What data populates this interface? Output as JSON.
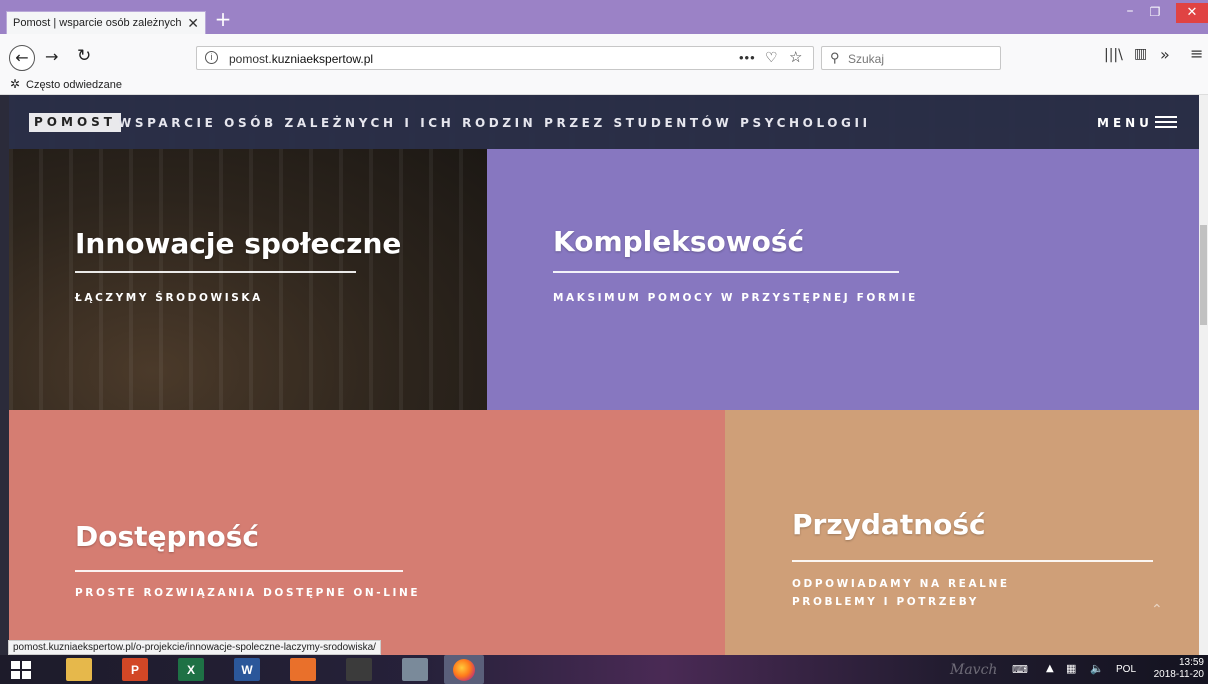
{
  "browser": {
    "tab_title": "Pomost | wsparcie osób zależnych i",
    "tab_close": "✕",
    "new_tab": "+",
    "url_prefix": "pomost.",
    "url_host": "kuzniaekspertow.pl",
    "search_placeholder": "Szukaj",
    "bookmark_label": "Często odwiedzane",
    "status_url": "pomost.kuzniaekspertow.pl/o-projekcie/innowacje-spoleczne-laczymy-srodowiska/"
  },
  "site": {
    "logo": "POMOST",
    "tagline": "WSPARCIE OSÓB ZALEŻNYCH I ICH RODZIN PRZEZ STUDENTÓW PSYCHOLOGII",
    "menu_label": "MENU"
  },
  "tiles": [
    {
      "title": "Innowacje społeczne",
      "subtitle": "ŁĄCZYMY ŚRODOWISKA",
      "color": "#2c241c"
    },
    {
      "title": "Kompleksowość",
      "subtitle": "MAKSIMUM POMOCY W PRZYSTĘPNEJ FORMIE",
      "color": "#8777c0"
    },
    {
      "title": "Dostępność",
      "subtitle": "PROSTE ROZWIĄZANIA DOSTĘPNE ON-LINE",
      "color": "#d57d72"
    },
    {
      "title": "Przydatność",
      "subtitle": "ODPOWIADAMY NA REALNE PROBLEMY I POTRZEBY",
      "color": "#cf9f78"
    }
  ],
  "taskbar": {
    "ppt_glyph": "P",
    "xls_glyph": "X",
    "word_glyph": "W",
    "lang": "POL",
    "time": "13:59",
    "date": "2018-11-20"
  },
  "icons": {
    "back": "back-arrow-icon",
    "forward": "forward-arrow-icon",
    "reload": "reload-icon",
    "search": "search-icon",
    "menu": "hamburger-icon"
  },
  "colors": {
    "tab_bar": "#9b82c6",
    "site_bar": "#282d46",
    "close_button": "#e04343"
  }
}
